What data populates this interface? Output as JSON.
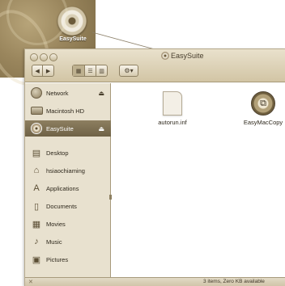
{
  "desktop": {
    "disc_label": "EasySuite"
  },
  "window": {
    "title": "EasySuite",
    "toolbar": {
      "back": "◀",
      "forward": "▶",
      "action": "⚙▾"
    },
    "status": "3 items, Zero KB available"
  },
  "sidebar": {
    "devices": [
      {
        "label": "Network",
        "icon": "globe-icon",
        "eject": "⏏"
      },
      {
        "label": "Macintosh HD",
        "icon": "hard-drive-icon"
      },
      {
        "label": "EasySuite",
        "icon": "disc-icon",
        "eject": "⏏",
        "selected": true
      }
    ],
    "places": [
      {
        "label": "Desktop",
        "icon": "desktop-icon",
        "glyph": "▤"
      },
      {
        "label": "hsiaochiaming",
        "icon": "home-icon",
        "glyph": "⌂"
      },
      {
        "label": "Applications",
        "icon": "applications-icon",
        "glyph": "A"
      },
      {
        "label": "Documents",
        "icon": "documents-icon",
        "glyph": "▯"
      },
      {
        "label": "Movies",
        "icon": "movies-icon",
        "glyph": "▦"
      },
      {
        "label": "Music",
        "icon": "music-icon",
        "glyph": "♪"
      },
      {
        "label": "Pictures",
        "icon": "pictures-icon",
        "glyph": "▣"
      }
    ]
  },
  "files": [
    {
      "name": "autorun.inf",
      "icon": "document-icon"
    },
    {
      "name": "EasyMacCopy",
      "icon": "app-icon"
    }
  ],
  "colors": {
    "accent": "#7d6f51",
    "sidebar": "#e8e1cf",
    "selection": "#7a6c4f"
  }
}
